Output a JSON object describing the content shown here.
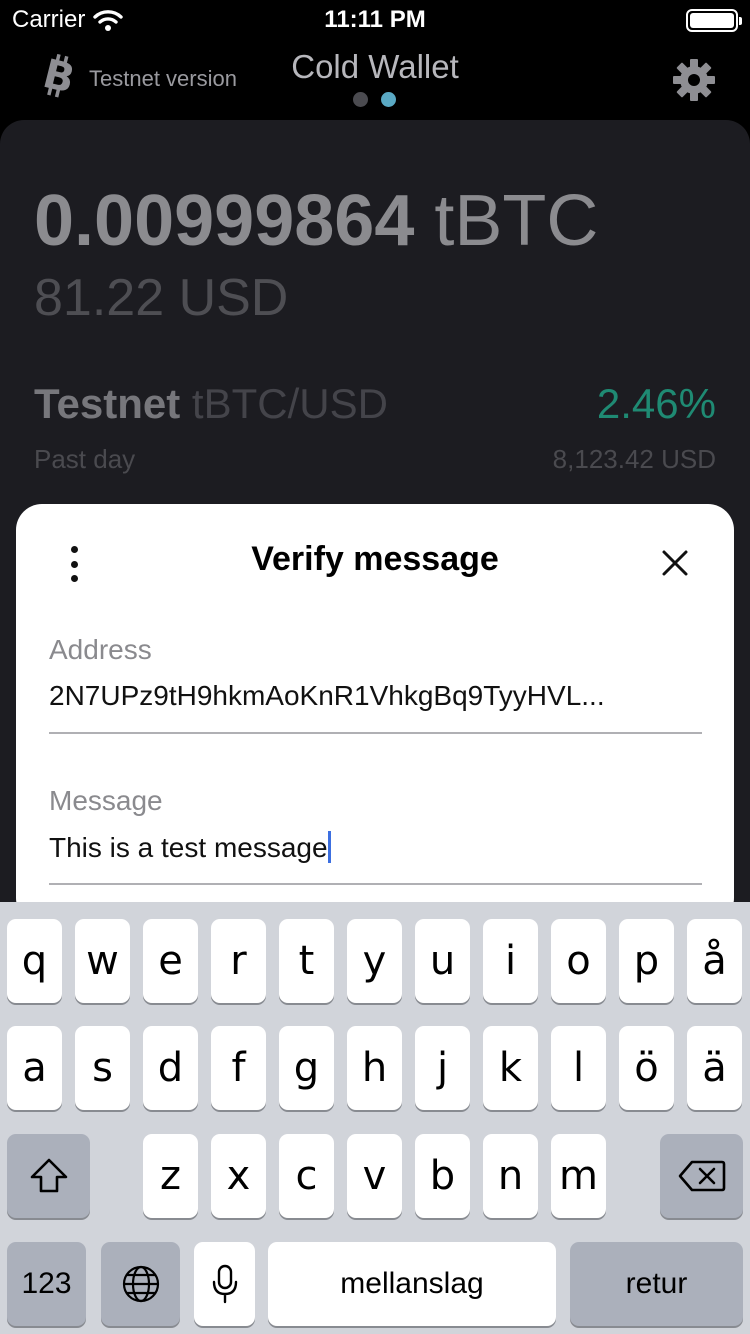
{
  "status_bar": {
    "carrier": "Carrier",
    "time": "11:11 PM"
  },
  "header": {
    "testnet_label": "Testnet version",
    "title": "Cold Wallet",
    "page_count": 2,
    "active_page": 2
  },
  "wallet": {
    "balance_amount": "0.00999864",
    "balance_unit": "tBTC",
    "fiat_balance": "81.22 USD",
    "pair_network": "Testnet",
    "pair": "tBTC/USD",
    "change": "2.46%",
    "period": "Past day",
    "price": "8,123.42 USD"
  },
  "modal": {
    "title": "Verify message",
    "address_label": "Address",
    "address_value": "2N7UPz9tH9hkmAoKnR1VhkgBq9TyyHVL...",
    "message_label": "Message",
    "message_value": "This is a test message"
  },
  "keyboard": {
    "row1": [
      "q",
      "w",
      "e",
      "r",
      "t",
      "y",
      "u",
      "i",
      "o",
      "p",
      "å"
    ],
    "row2": [
      "a",
      "s",
      "d",
      "f",
      "g",
      "h",
      "j",
      "k",
      "l",
      "ö",
      "ä"
    ],
    "row3": [
      "z",
      "x",
      "c",
      "v",
      "b",
      "n",
      "m"
    ],
    "numbers_key": "123",
    "space_key": "mellanslag",
    "return_key": "retur"
  },
  "colors": {
    "accent_green": "#1f8a73",
    "page_dot_active": "#5aa9c4",
    "caret": "#3c6fe0"
  }
}
